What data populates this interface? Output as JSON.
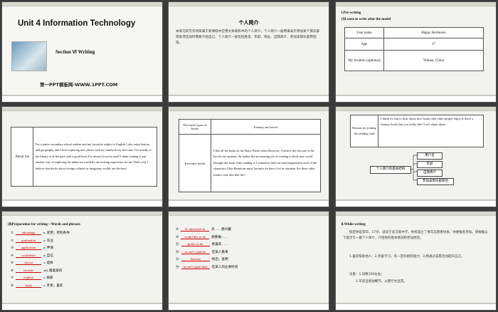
{
  "slides": [
    {
      "num": "1",
      "title": "Unit 4  Information Technology",
      "section": "Section Ⅵ   Writing",
      "footer": "第一PPT模板网-WWW.1PPT.COM"
    },
    {
      "num": "2",
      "heading": "个人简介",
      "body": "本单元的写作项目属于新课标中应用文体裁和中的个人简介。个人简介一般用来表示参加某个俱乐部或某项活动时需要介绍自己。个人简介一般包括姓名、年龄、地址、自我简介、参加该俱乐部原因等。"
    },
    {
      "num": "3",
      "h1": "Ⅰ.Pre-writing",
      "h2": "(Ⅰ)Learn to write after the model",
      "rows": [
        [
          "User name",
          "Happy Hermione"
        ],
        [
          "Age",
          "17"
        ],
        [
          "My location (optional)",
          "Wuhan, China"
        ]
      ]
    },
    {
      "num": "4",
      "label": "About me",
      "text": "I'm a senior secondary school student and my favourite subject is English.I also enjoy history and geography, and I love exploring new places with my family.In my free time, I'm usually in the library or at the park with a good book.I've always loved to read! I think reading is just another way of exploring the unknown world.It's an exciting experience for me.That's why I believe that books about foreign cultures or imaginary worlds are the best!"
    },
    {
      "num": "5",
      "rows": [
        [
          "Favourite types of books",
          "Fantasy and travel"
        ],
        [
          "Favourite books",
          "I like all the books in the Harry Potter series.However, I believe the first one is the best.In my opinion, the author did an amazing job of creating a whole new world through this book.After reading it, I wanted to find out what happened to each of the characters.I like Hermione most, because we have a lot in common.Are there other readers who also like her?"
        ]
      ]
    },
    {
      "num": "6",
      "label": "Reason for joining the reading club",
      "text": "I think it's fun to hear about new books that other people enjoy.Is there a fantasy book that you really like? Let's share ideas.",
      "root": "个人简介的基本结构",
      "items": [
        "用户名",
        "年龄",
        "自我简介",
        "参加该俱乐部原因"
      ]
    },
    {
      "num": "7",
      "heading": "(Ⅱ)Preparation for writing—Words and phrases",
      "items": [
        [
          "①",
          "advantage",
          "n. 优势；有利条件"
        ],
        [
          "②",
          "graduation",
          "n. 毕业"
        ],
        [
          "③",
          "application",
          "n. 申请"
        ],
        [
          "④",
          "confidence",
          "n. 自信"
        ],
        [
          "⑤",
          "choose",
          "v. 选择"
        ],
        [
          "⑥",
          "favorite",
          "adj. 最喜爱的"
        ],
        [
          "⑦",
          "explore",
          "v. 探索"
        ],
        [
          "⑧",
          "enjoy",
          "v. 享受；喜欢"
        ]
      ]
    },
    {
      "num": "8",
      "items": [
        [
          "⑨",
          "be interested in",
          "对……感兴趣"
        ],
        [
          "⑩",
          "would like to do",
          "想要做……"
        ],
        [
          "⑪",
          "prefer to do",
          "更喜欢……"
        ],
        [
          "⑫",
          "in one's opinion",
          "在某人看来"
        ],
        [
          "⑬",
          "find out",
          "找出；查明"
        ],
        [
          "⑭",
          "in one's spare time",
          "在某人的业余时间"
        ]
      ]
    },
    {
      "num": "9",
      "heading": "Ⅱ.While-writing",
      "para1": "假定你是李华，17岁，就读于武汉某中学。你校成立了青年志愿者协会，你想报名参加。请根据以下提示写一篇个人简介，介绍你的基本情况和参加原因。",
      "para2": "1.喜欢帮助他人；2.热爱学习，有一定的组织能力；3.想通过志愿活动提升自己。",
      "notes": [
        "注意：1.词数100左右；",
        "2.可适当增加细节，以使行文连贯。"
      ]
    }
  ]
}
